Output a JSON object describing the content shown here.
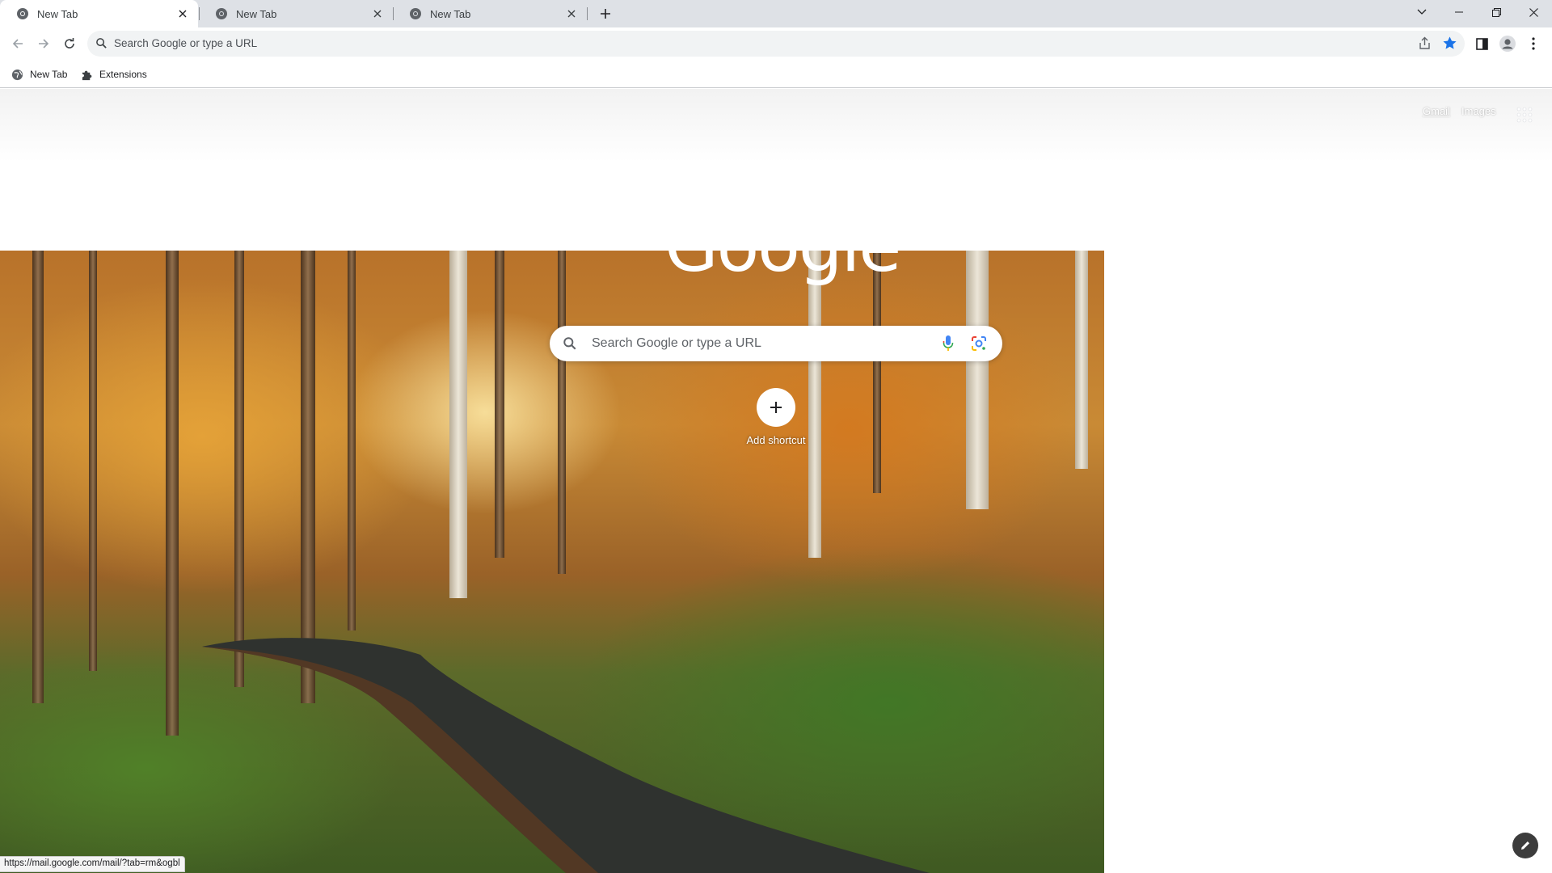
{
  "browser": {
    "tabs": [
      {
        "title": "New Tab",
        "active": true
      },
      {
        "title": "New Tab",
        "active": false
      },
      {
        "title": "New Tab",
        "active": false
      }
    ],
    "omnibox": {
      "placeholder": "Search Google or type a URL"
    },
    "bookmarks": [
      {
        "label": "New Tab",
        "icon": "globe-icon"
      },
      {
        "label": "Extensions",
        "icon": "puzzle-icon"
      }
    ],
    "status_url": "https://mail.google.com/mail/?tab=rm&ogbl"
  },
  "ntp": {
    "logo": "Google",
    "search_placeholder": "Search Google or type a URL",
    "links": {
      "gmail": "Gmail",
      "images": "Images"
    },
    "shortcut_label": "Add shortcut"
  },
  "colors": {
    "tabstrip_bg": "#dee1e6",
    "omnibox_bg": "#f1f3f4",
    "star_accent": "#1a73e8"
  }
}
